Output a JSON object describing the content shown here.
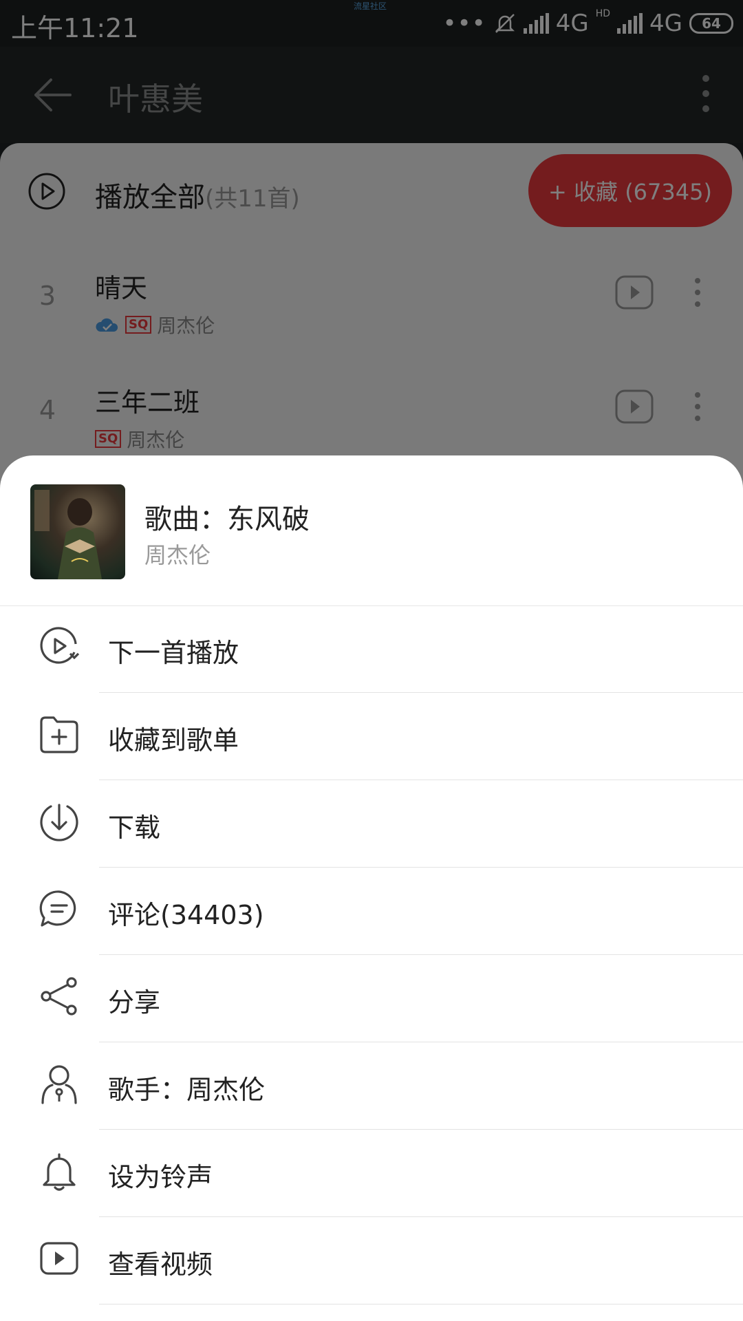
{
  "status_bar": {
    "time": "上午11:21",
    "watermark": "流星社区",
    "network1": "4G",
    "network2": "4G",
    "hd_label": "HD",
    "battery": "64"
  },
  "header": {
    "title": "叶惠美"
  },
  "list": {
    "play_all_label": "播放全部",
    "play_all_count": "(共11首)",
    "collect_button": "+ 收藏 (67345)",
    "songs": [
      {
        "number": "3",
        "title": "晴天",
        "badge": "SQ",
        "artist": "周杰伦",
        "cloud": true
      },
      {
        "number": "4",
        "title": "三年二班",
        "badge": "SQ",
        "artist": "周杰伦",
        "cloud": false
      }
    ]
  },
  "sheet": {
    "song": "歌曲：东风破",
    "artist": "周杰伦",
    "menu": [
      {
        "label": "下一首播放",
        "icon": "play-next-icon"
      },
      {
        "label": "收藏到歌单",
        "icon": "folder-add-icon"
      },
      {
        "label": "下载",
        "icon": "download-icon"
      },
      {
        "label": "评论(34403)",
        "icon": "comment-icon"
      },
      {
        "label": "分享",
        "icon": "share-icon"
      },
      {
        "label": "歌手：周杰伦",
        "icon": "artist-icon"
      },
      {
        "label": "设为铃声",
        "icon": "bell-icon"
      },
      {
        "label": "查看视频",
        "icon": "video-icon"
      }
    ]
  },
  "colors": {
    "accent": "#e8383d",
    "header_bg": "#222727"
  }
}
